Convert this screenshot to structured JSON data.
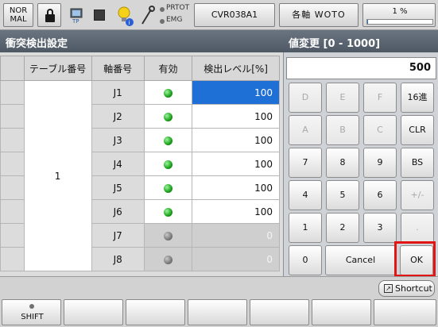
{
  "topbar": {
    "mode_label": "NOR\nMAL",
    "tp_label": "TP",
    "prtot_label": "PRTOT",
    "emg_label": "EMG",
    "program_name": "CVR038A1",
    "axis_mode": "各軸 WOTO",
    "speed_text": "1 %",
    "speed_percent": 1
  },
  "screen": {
    "title": "衝突検出設定",
    "columns": [
      "テーブル番号",
      "軸番号",
      "有効",
      "検出レベル[%]"
    ],
    "table_number": "1",
    "rows": [
      {
        "axis": "J1",
        "enabled": true,
        "level": "100",
        "selected": true
      },
      {
        "axis": "J2",
        "enabled": true,
        "level": "100",
        "selected": false
      },
      {
        "axis": "J3",
        "enabled": true,
        "level": "100",
        "selected": false
      },
      {
        "axis": "J4",
        "enabled": true,
        "level": "100",
        "selected": false
      },
      {
        "axis": "J5",
        "enabled": true,
        "level": "100",
        "selected": false
      },
      {
        "axis": "J6",
        "enabled": true,
        "level": "100",
        "selected": false
      },
      {
        "axis": "J7",
        "enabled": false,
        "level": "0",
        "selected": false
      },
      {
        "axis": "J8",
        "enabled": false,
        "level": "0",
        "selected": false
      }
    ]
  },
  "dialog": {
    "title": "値変更 [0 - 1000]",
    "value": "500",
    "keys": [
      {
        "label": "D",
        "enabled": false
      },
      {
        "label": "E",
        "enabled": false
      },
      {
        "label": "F",
        "enabled": false
      },
      {
        "label": "16進",
        "enabled": true
      },
      {
        "label": "A",
        "enabled": false
      },
      {
        "label": "B",
        "enabled": false
      },
      {
        "label": "C",
        "enabled": false
      },
      {
        "label": "CLR",
        "enabled": true
      },
      {
        "label": "7",
        "enabled": true
      },
      {
        "label": "8",
        "enabled": true
      },
      {
        "label": "9",
        "enabled": true
      },
      {
        "label": "BS",
        "enabled": true
      },
      {
        "label": "4",
        "enabled": true
      },
      {
        "label": "5",
        "enabled": true
      },
      {
        "label": "6",
        "enabled": true
      },
      {
        "label": "+/-",
        "enabled": false
      },
      {
        "label": "1",
        "enabled": true
      },
      {
        "label": "2",
        "enabled": true
      },
      {
        "label": "3",
        "enabled": true
      },
      {
        "label": ".",
        "enabled": false
      }
    ],
    "zero_label": "0",
    "cancel_label": "Cancel",
    "ok_label": "OK"
  },
  "bottom": {
    "shortcut_label": "Shortcut",
    "shift_label": "SHIFT"
  },
  "colors": {
    "selection": "#1e6fd6",
    "highlight_outline": "#e21515",
    "led_on": "#1aa01a",
    "led_off": "#7a7a7a"
  }
}
